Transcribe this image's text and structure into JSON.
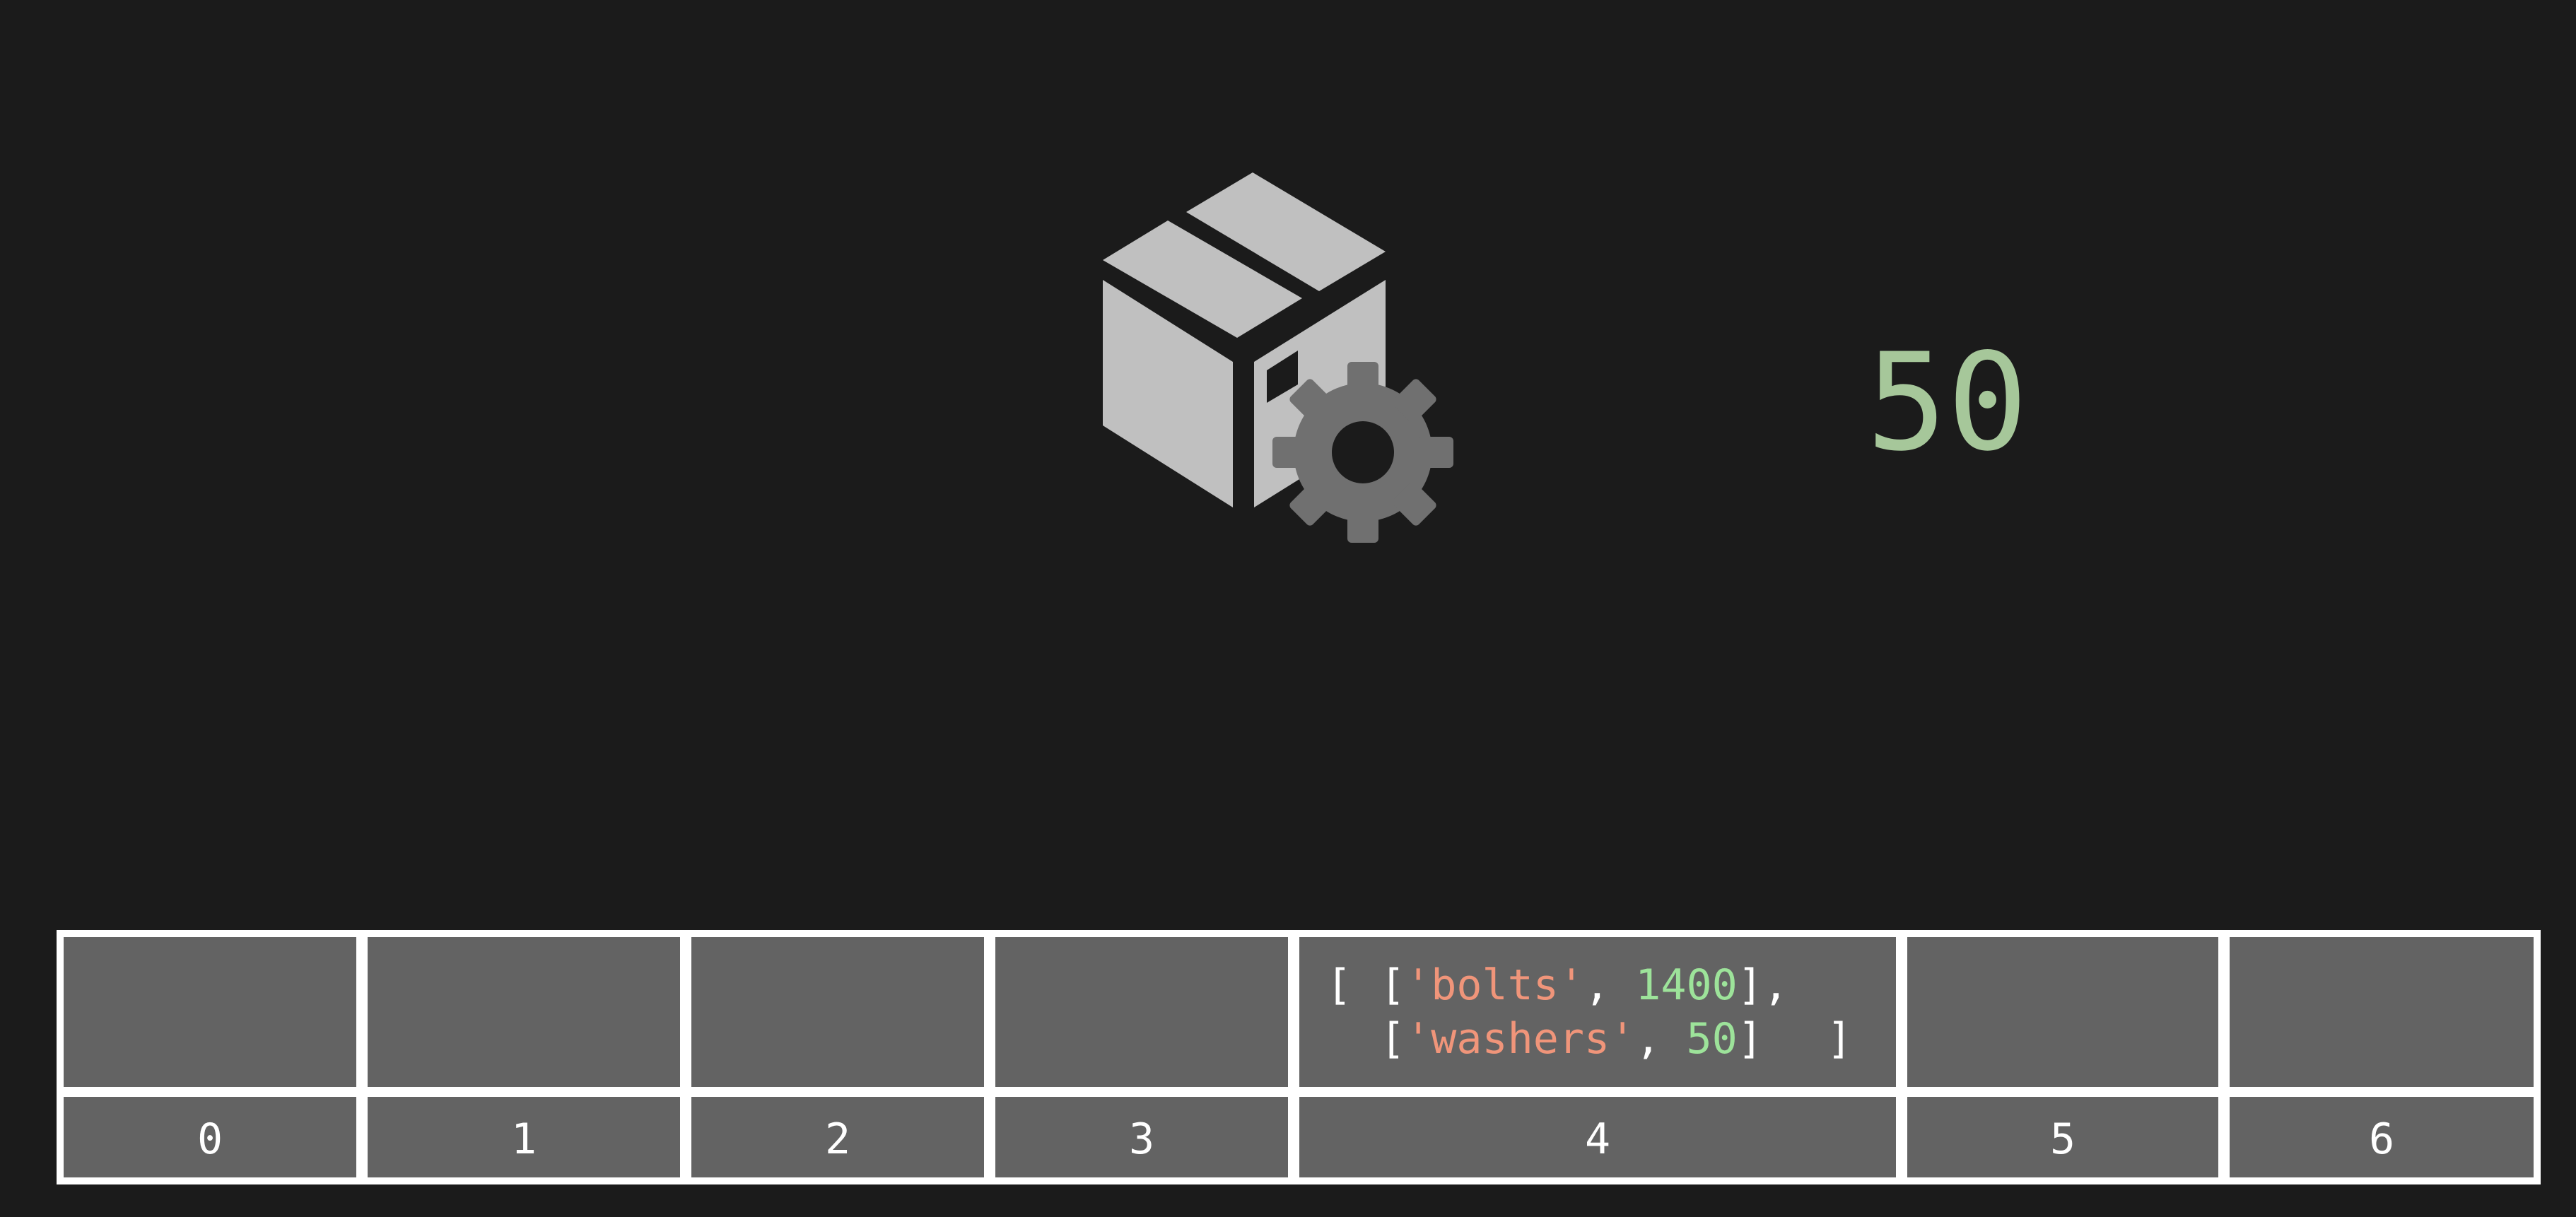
{
  "icons": {
    "package": "package-with-gear-icon"
  },
  "colors": {
    "background": "#1b1b1b",
    "cell_fill": "#636363",
    "cell_border": "#ffffff",
    "box": "#c0c0c0",
    "gear": "#707070",
    "value": "#a6c79a",
    "string": "#f0957a",
    "number": "#9de39a"
  },
  "readout": {
    "value": "50"
  },
  "table": {
    "indices": [
      "0",
      "1",
      "2",
      "3",
      "4",
      "5",
      "6"
    ],
    "slot4": {
      "open_bracket": "[",
      "row1": {
        "open": "[",
        "key": "'bolts'",
        "sep": ", ",
        "qty": "1400",
        "close": "],"
      },
      "row2": {
        "open": "[",
        "key": "'washers'",
        "sep": ", ",
        "qty": "50",
        "close": "]"
      },
      "close_bracket": "]"
    }
  }
}
